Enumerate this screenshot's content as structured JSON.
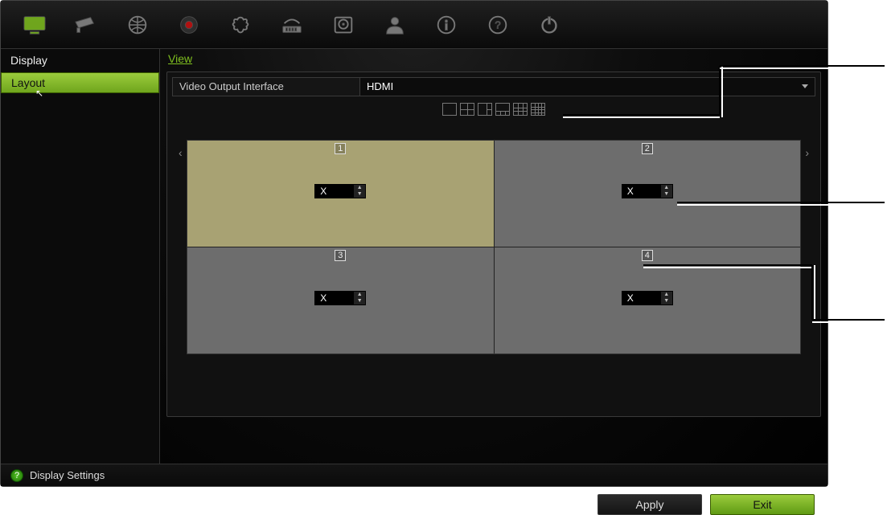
{
  "toolbar_icons": [
    "monitor-icon",
    "camera-icon",
    "globe-icon",
    "record-icon",
    "alarm-icon",
    "network-icon",
    "hdd-icon",
    "user-icon",
    "info-icon",
    "help-icon",
    "power-icon"
  ],
  "sidebar": {
    "heading": "Display",
    "items": [
      "Layout"
    ]
  },
  "tab": {
    "label": "View"
  },
  "form": {
    "output_label": "Video Output Interface",
    "output_value": "HDMI"
  },
  "layout_modes": [
    "1x1",
    "2x2",
    "1+5",
    "1+7",
    "3x3",
    "4x4"
  ],
  "nav": {
    "prev": "‹",
    "next": "›"
  },
  "cells": [
    {
      "num": "1",
      "value": "X",
      "selected": true
    },
    {
      "num": "2",
      "value": "X",
      "selected": false
    },
    {
      "num": "3",
      "value": "X",
      "selected": false
    },
    {
      "num": "4",
      "value": "X",
      "selected": false
    }
  ],
  "buttons": {
    "apply": "Apply",
    "exit": "Exit"
  },
  "status": {
    "text": "Display Settings"
  }
}
